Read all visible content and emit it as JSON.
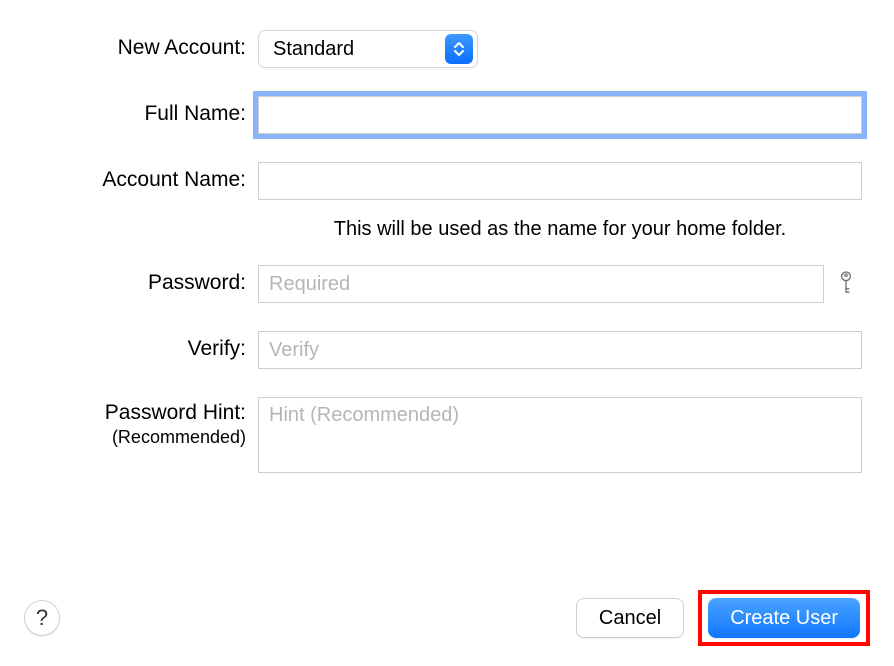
{
  "labels": {
    "new_account": "New Account:",
    "full_name": "Full Name:",
    "account_name": "Account Name:",
    "password": "Password:",
    "verify": "Verify:",
    "password_hint": "Password Hint:",
    "password_hint_sub": "(Recommended)"
  },
  "new_account": {
    "selected": "Standard"
  },
  "full_name": {
    "value": ""
  },
  "account_name": {
    "value": "",
    "helper": "This will be used as the name for your home folder."
  },
  "password": {
    "value": "",
    "placeholder": "Required"
  },
  "verify": {
    "value": "",
    "placeholder": "Verify"
  },
  "hint": {
    "value": "",
    "placeholder": "Hint (Recommended)"
  },
  "buttons": {
    "help": "?",
    "cancel": "Cancel",
    "create_user": "Create User"
  }
}
